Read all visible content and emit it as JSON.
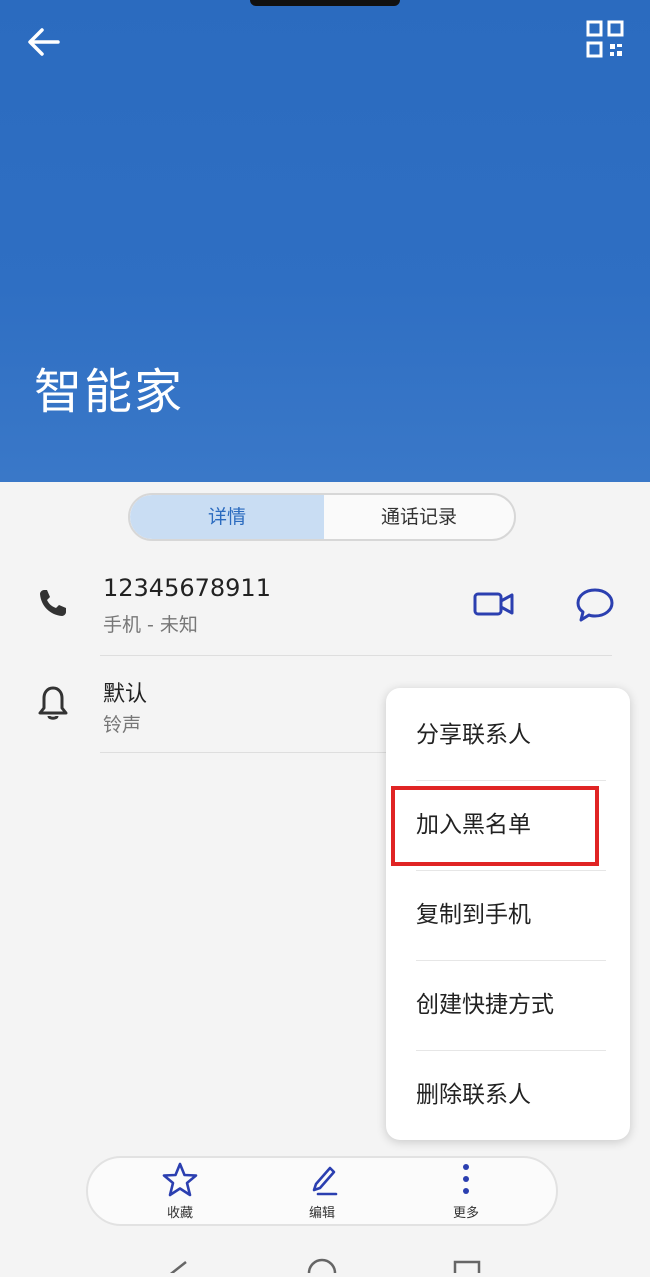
{
  "header": {
    "contact_name": "智能家",
    "icons": {
      "back": "back-arrow-icon",
      "qr": "qr-code-icon"
    },
    "bg_color": "#2f6fc3"
  },
  "tabs": [
    {
      "label": "详情",
      "active": true
    },
    {
      "label": "通话记录",
      "active": false
    }
  ],
  "phone": {
    "number": "12345678911",
    "subtitle": "手机 - 未知",
    "icons": {
      "phone": "phone-icon",
      "video": "video-call-icon",
      "message": "message-icon"
    }
  },
  "ringtone": {
    "title": "默认",
    "subtitle": "铃声",
    "icon": "bell-icon"
  },
  "menu": {
    "items": [
      "分享联系人",
      "加入黑名单",
      "复制到手机",
      "创建快捷方式",
      "删除联系人"
    ],
    "highlighted": "加入黑名单",
    "highlight_color": "#e02424"
  },
  "bottom_bar": {
    "favorite": "收藏",
    "edit": "编辑",
    "more": "更多",
    "accent": "#2b3fb0"
  }
}
